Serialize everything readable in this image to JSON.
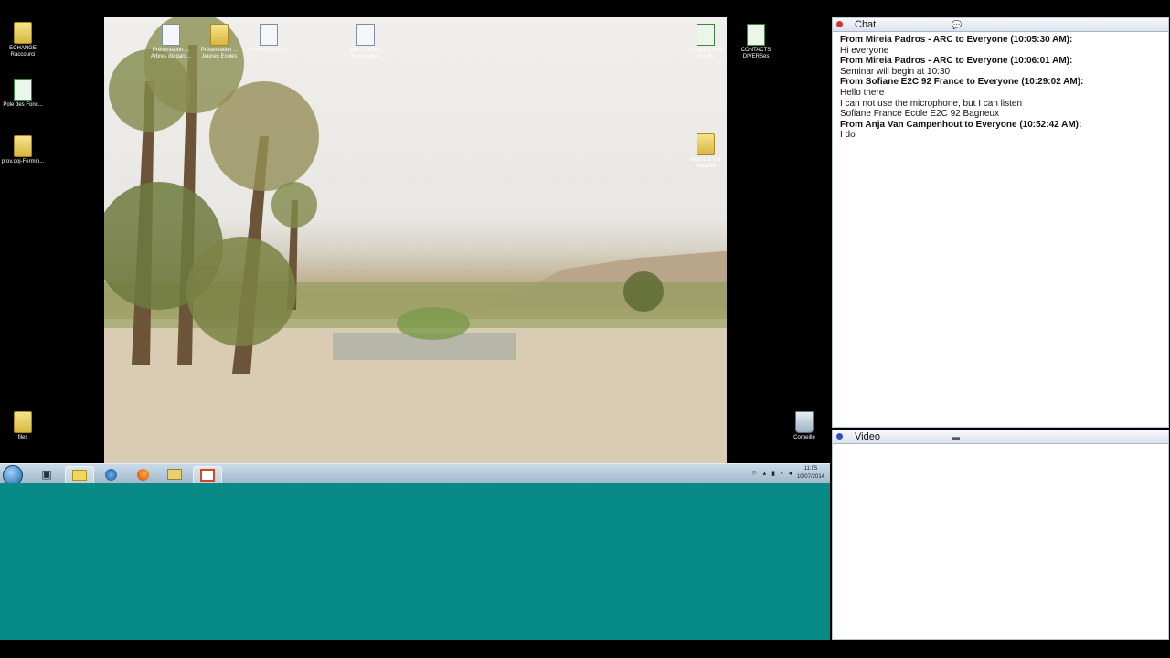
{
  "desktop": {
    "left_icons": [
      {
        "label": "ECHANGE\nRaccourci",
        "type": "folder"
      },
      {
        "label": "Pole des Fonc...",
        "type": "xls"
      },
      {
        "label": "prov.doj-Fermin...",
        "type": "folder"
      },
      {
        "label": "files",
        "type": "folder"
      }
    ],
    "top_icons": [
      {
        "label": "Présentation ...\nArbres de parc...",
        "type": "doc"
      },
      {
        "label": "Présentation ...\nJeunes Ecoles",
        "type": "folder"
      },
      {
        "label": "Présentation C...",
        "type": "doc"
      },
      {
        "label": "plan d'action\nRencontres",
        "type": "doc"
      }
    ],
    "right_icons": [
      {
        "label": "Contacts chef\nécoles",
        "type": "xls"
      },
      {
        "label": "CONTACTS\nDIVERSes",
        "type": "xls"
      },
      {
        "label": "videos à voir\nstagiaire",
        "type": "folder"
      },
      {
        "label": "Corbeille",
        "type": "bin"
      }
    ]
  },
  "taskbar": {
    "apps": [
      "start-orb",
      "file-manager",
      "folder",
      "browser-globe",
      "firefox",
      "explorer",
      "presentation"
    ],
    "clock_time": "11:05",
    "clock_date": "10/07/2014"
  },
  "chat": {
    "title": "Chat",
    "status_color": "#d83030",
    "messages": [
      {
        "kind": "from",
        "text": "From Mireia Padros - ARC to Everyone (10:05:30 AM):"
      },
      {
        "kind": "body",
        "text": "Hi everyone"
      },
      {
        "kind": "from",
        "text": "From Mireia Padros - ARC to Everyone (10:06:01 AM):"
      },
      {
        "kind": "body",
        "text": "Seminar will begin at 10:30"
      },
      {
        "kind": "from",
        "text": "From Sofiane E2C 92 France to Everyone (10:29:02 AM):"
      },
      {
        "kind": "body",
        "text": "Hello there"
      },
      {
        "kind": "body",
        "text": "I can not use the microphone, but I can listen"
      },
      {
        "kind": "body",
        "text": "Sofiane France Ecole E2C 92 Bagneux"
      },
      {
        "kind": "from",
        "text": "From Anja Van Campenhout to Everyone (10:52:42 AM):"
      },
      {
        "kind": "body",
        "text": "I do"
      }
    ]
  },
  "video": {
    "title": "Video",
    "status_color": "#3050c0"
  }
}
